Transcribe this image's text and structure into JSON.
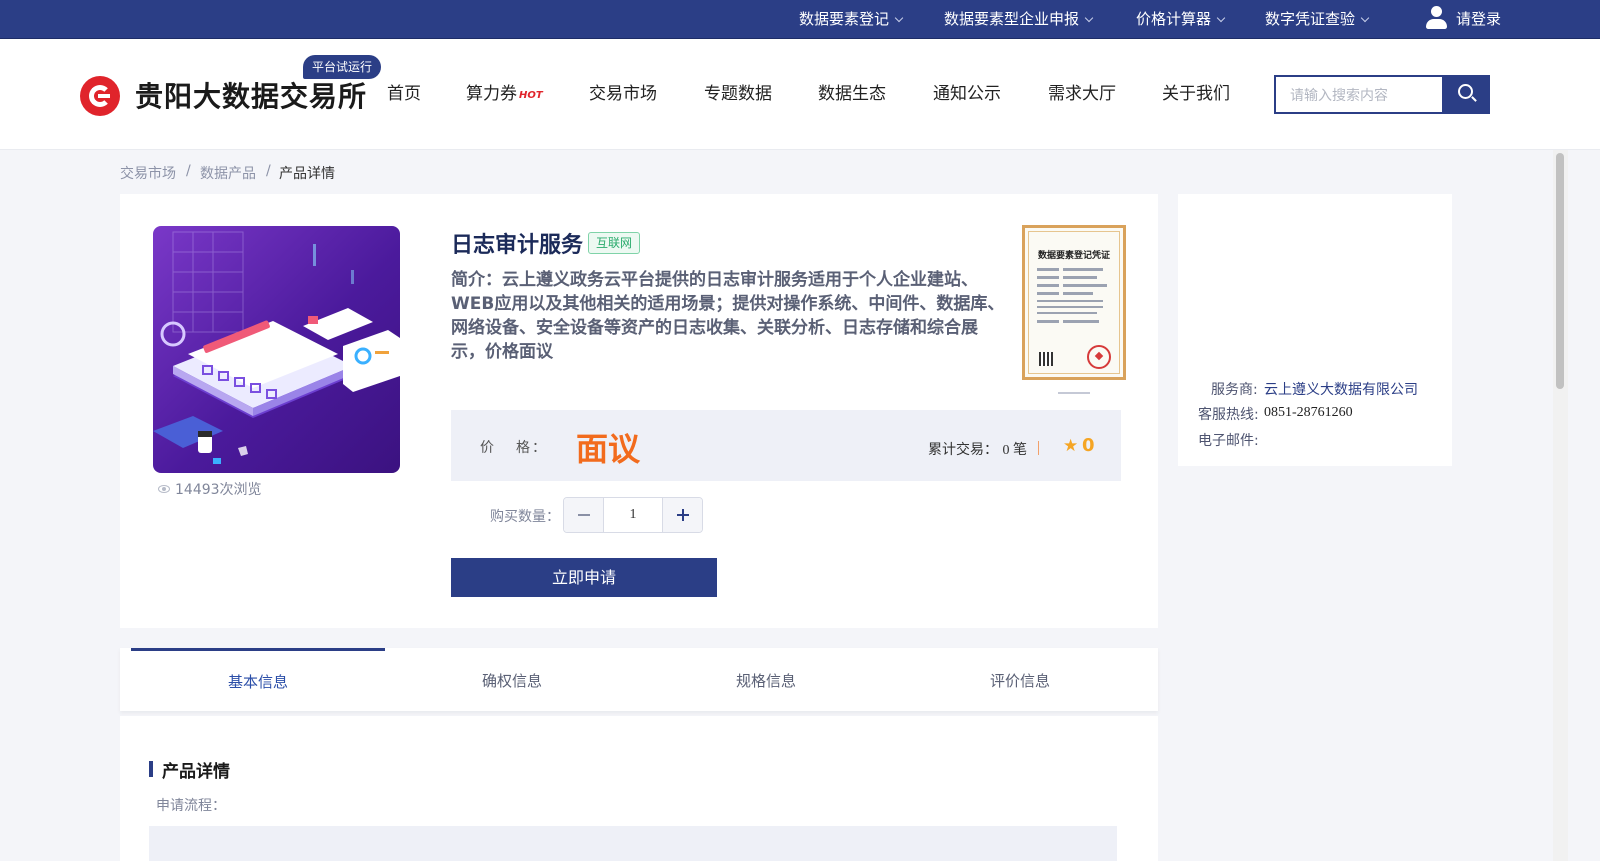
{
  "topbar": {
    "items": [
      {
        "label": "数据要素登记"
      },
      {
        "label": "数据要素型企业申报"
      },
      {
        "label": "价格计算器"
      },
      {
        "label": "数字凭证查验"
      }
    ],
    "login": "请登录"
  },
  "header": {
    "logo_text": "贵阳大数据交易所",
    "badge": "平台试运行",
    "nav": [
      {
        "label": "首页"
      },
      {
        "label": "算力券",
        "hot": "HOT"
      },
      {
        "label": "交易市场"
      },
      {
        "label": "专题数据"
      },
      {
        "label": "数据生态"
      },
      {
        "label": "通知公示"
      },
      {
        "label": "需求大厅"
      },
      {
        "label": "关于我们"
      }
    ],
    "search_placeholder": "请输入搜索内容"
  },
  "breadcrumb": [
    "交易市场",
    "数据产品",
    "产品详情"
  ],
  "breadcrumb_sep": "/",
  "product": {
    "title": "日志审计服务",
    "tag": "互联网",
    "intro": "简介：云上遵义政务云平台提供的日志审计服务适用于个人企业建站、WEB应用以及其他相关的适用场景；提供对操作系统、中间件、数据库、网络设备、安全设备等资产的日志收集、关联分析、日志存储和综合展示，价格面议",
    "views": "14493次浏览",
    "certificate_title": "数据要素登记凭证",
    "price_label_a": "价",
    "price_label_b": "格：",
    "price_value": "面议",
    "trade_label": "累计交易：",
    "trade_value": "0 笔",
    "rating": "0",
    "qty_label": "购买数量：",
    "qty_value": "1",
    "apply_label": "立即申请"
  },
  "provider": {
    "service_label": "服务商:",
    "service_value": "云上遵义大数据有限公司",
    "hotline_label": "客服热线:",
    "hotline_value": "0851-28761260",
    "email_label": "电子邮件:"
  },
  "tabs": [
    {
      "label": "基本信息",
      "active": true
    },
    {
      "label": "确权信息"
    },
    {
      "label": "规格信息"
    },
    {
      "label": "评价信息"
    }
  ],
  "detail": {
    "title": "产品详情",
    "flow_label": "申请流程："
  },
  "colors": {
    "primary": "#2b3e86",
    "accent_orange": "#f26b1d",
    "tag_green": "#2bab6d",
    "star": "#f5a524",
    "logo_red": "#e0242b"
  },
  "icons": [
    "chevron-down-icon",
    "user-icon",
    "search-icon",
    "eye-icon",
    "star-icon",
    "minus-icon",
    "plus-icon"
  ]
}
